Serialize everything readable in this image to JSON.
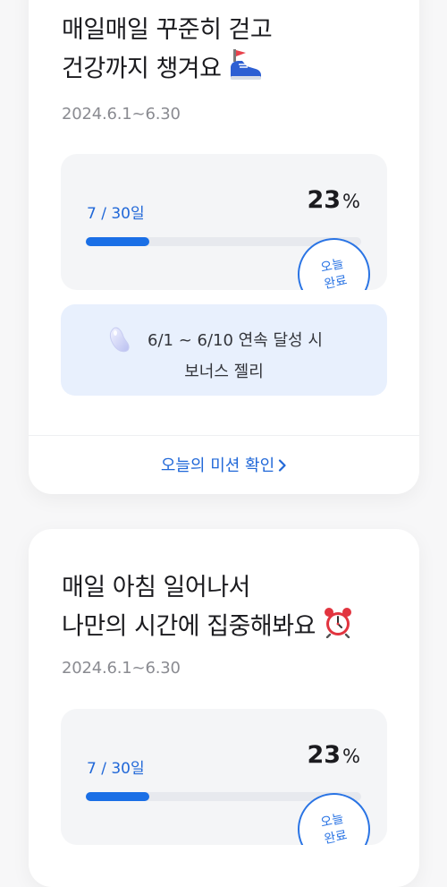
{
  "challenges": [
    {
      "title_line1": "매일매일 꾸준히 걷고",
      "title_line2": "건강까지 챙겨요",
      "title_icon": "running-shoe-icon",
      "period": "2024.6.1~6.30",
      "progress": {
        "days": "7 / 30일",
        "percent_value": "23",
        "percent_sign": "%",
        "fraction": 0.23
      },
      "stamp": {
        "line1": "오늘",
        "line2": "완료"
      },
      "bonus": {
        "icon": "jelly-bean-icon",
        "line1": "6/1 ~ 6/10 연속 달성 시",
        "line2": "보너스 젤리"
      },
      "mission_link": "오늘의 미션 확인"
    },
    {
      "title_line1": "매일 아침 일어나서",
      "title_line2": "나만의 시간에 집중해봐요",
      "title_icon": "alarm-clock-icon",
      "period": "2024.6.1~6.30",
      "progress": {
        "days": "7 / 30일",
        "percent_value": "23",
        "percent_sign": "%",
        "fraction": 0.23
      },
      "stamp": {
        "line1": "오늘",
        "line2": "완료"
      }
    }
  ],
  "colors": {
    "accent": "#1a6fe6",
    "link": "#2168d8",
    "bonus_bg": "#e8f0fd",
    "track": "#e7e9ee"
  }
}
